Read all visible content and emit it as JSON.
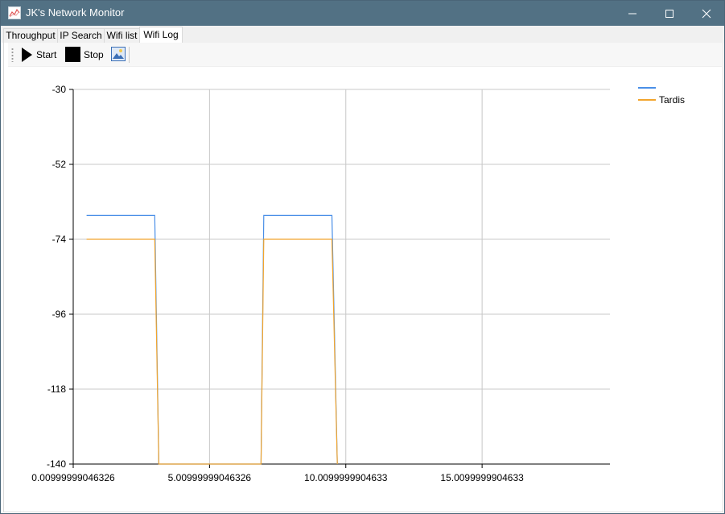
{
  "window": {
    "title": "JK's Network Monitor"
  },
  "tabs": [
    {
      "label": "Throughput"
    },
    {
      "label": "IP Search"
    },
    {
      "label": "Wifi list"
    },
    {
      "label": "Wifi Log"
    }
  ],
  "active_tab": "Wifi Log",
  "toolbar": {
    "start_label": "Start",
    "stop_label": "Stop"
  },
  "icons": {
    "app": "network-chart-icon",
    "minimize": "minimize-icon",
    "maximize": "maximize-icon",
    "close": "close-icon",
    "start": "play-icon",
    "stop": "stop-icon",
    "save_image": "image-icon"
  },
  "colors": {
    "titlebar": "#527184",
    "series_1": "#4a8fe7",
    "series_2": "#f2a52d",
    "grid": "#c8c8c8"
  },
  "chart_data": {
    "type": "line",
    "x_ticks": [
      "0.00999999046326",
      "5.00999999046326",
      "10.0099999904633",
      "15.0099999904633"
    ],
    "x_tick_values": [
      0.00999999046326,
      5.00999999046326,
      10.0099999904633,
      15.0099999904633
    ],
    "y_ticks": [
      "-30",
      "-52",
      "-74",
      "-96",
      "-118",
      "-140"
    ],
    "y_tick_values": [
      -30,
      -52,
      -74,
      -96,
      -118,
      -140
    ],
    "xlim": [
      0.00999999046326,
      19.7
    ],
    "ylim": [
      -140,
      -30
    ],
    "grid": true,
    "legend_position": "top-right",
    "series": [
      {
        "name": "",
        "color": "#4a8fe7",
        "x": [
          0.5,
          3.0,
          3.15,
          6.9,
          7.0,
          9.5,
          9.7
        ],
        "y": [
          -67,
          -67,
          -140,
          -140,
          -67,
          -67,
          -140
        ]
      },
      {
        "name": "Tardis",
        "color": "#f2a52d",
        "x": [
          0.5,
          3.0,
          3.15,
          6.9,
          7.0,
          9.5,
          9.7
        ],
        "y": [
          -74,
          -74,
          -140,
          -140,
          -74,
          -74,
          -140
        ]
      }
    ]
  }
}
